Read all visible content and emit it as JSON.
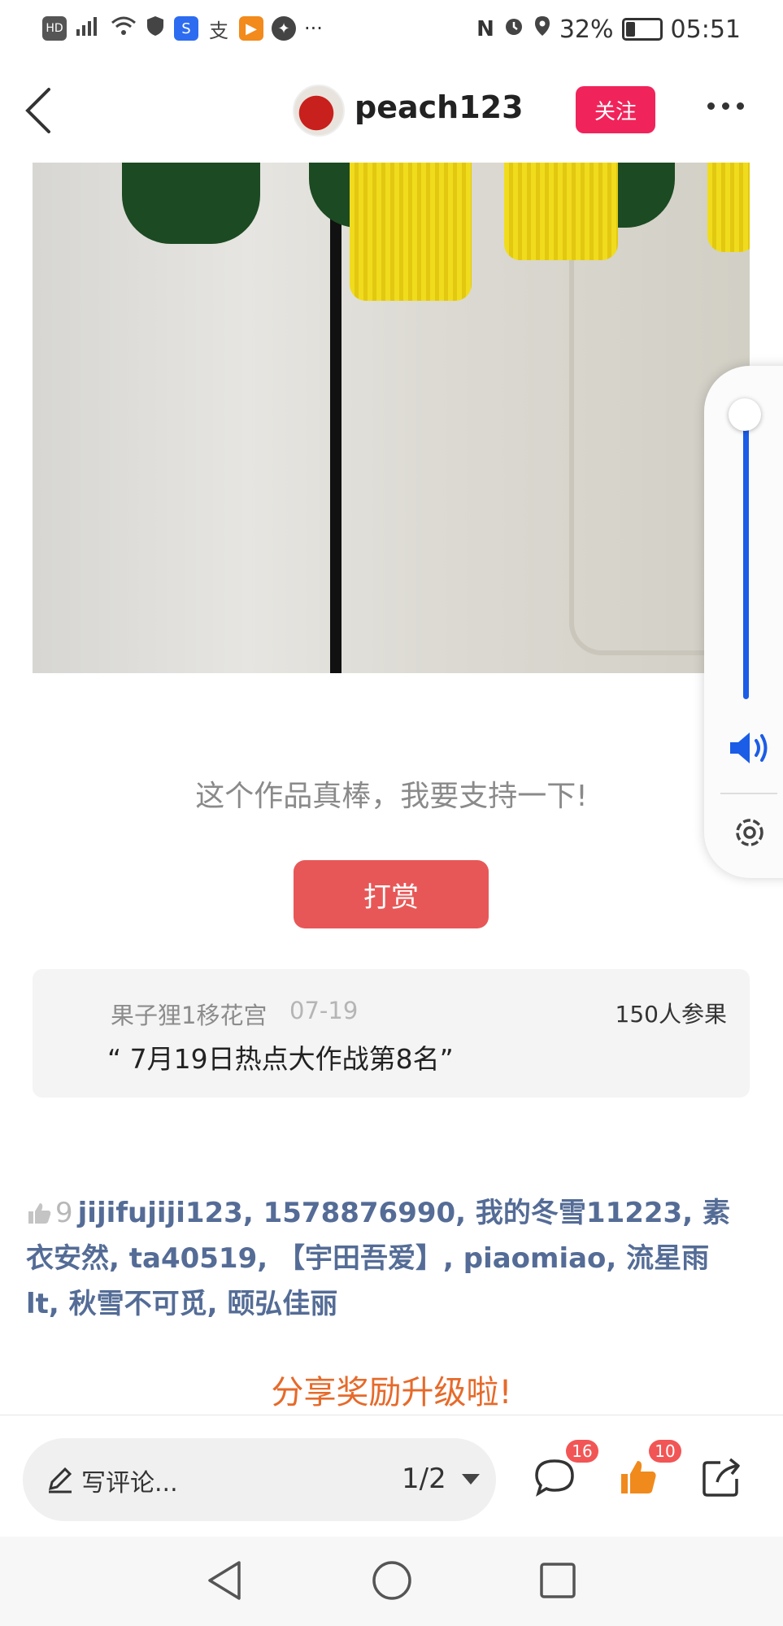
{
  "status_bar": {
    "left_icons": [
      "hd-icon",
      "signal-4g-icon",
      "wifi-icon",
      "shield-icon",
      "app-icon-blue",
      "alipay-icon",
      "video-app-icon",
      "safari-icon"
    ],
    "more": "···",
    "battery_percent": "32%",
    "battery_level": 0.32,
    "time": "05:51"
  },
  "header": {
    "username": "peach123",
    "follow_label": "关注"
  },
  "tip": {
    "prompt": "这个作品真棒，我要支持一下!",
    "button_label": "打赏"
  },
  "event": {
    "user": "果子狸1移花宫",
    "date": "07-19",
    "participants": "150人参果",
    "title": "“ 7月19日热点大作战第8名”"
  },
  "likes": {
    "count": "9",
    "names": "jijifujiji123, 1578876990, 我的冬雪11223, 素衣安然, ta40519, 【宇田吾爱】, piaomiao, 流星雨lt, 秋雪不可觅, 颐弘佳丽"
  },
  "promo": "分享奖励升级啦!",
  "bottom_bar": {
    "comment_placeholder": "写评论...",
    "page_indicator": "1/2",
    "comment_badge": "16",
    "like_badge": "10"
  },
  "volume": {
    "level": 1.0,
    "accent_color": "#1b5de6"
  },
  "colors": {
    "follow": "#f0245a",
    "tip_button": "#e85757",
    "liker_names": "#546c96",
    "promo": "#e66a2a",
    "badge": "#f25555"
  }
}
